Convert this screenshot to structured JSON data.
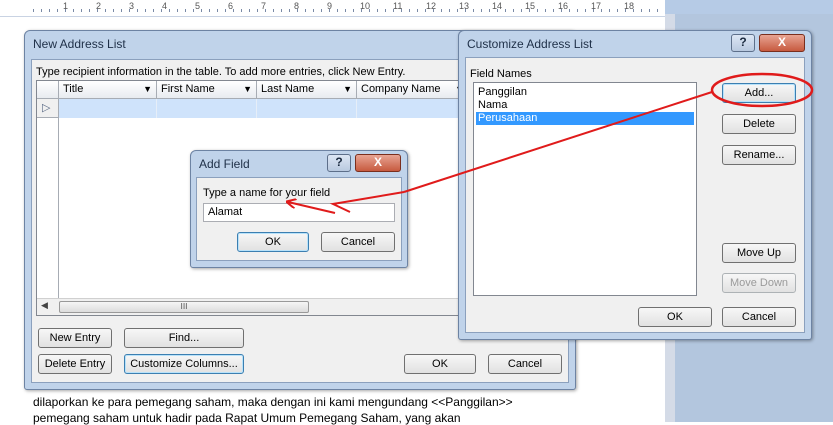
{
  "ruler": {
    "numbers": [
      "1",
      "2",
      "3",
      "4",
      "5",
      "6",
      "7",
      "8",
      "9",
      "10",
      "11",
      "12",
      "13",
      "14",
      "15",
      "16",
      "17",
      "18"
    ]
  },
  "document": {
    "line1": "dilaporkan ke para pemegang saham, maka dengan ini kami mengundang <<Panggilan>>",
    "line2": "pemegang saham untuk hadir pada Rapat Umum Pemegang Saham, yang akan"
  },
  "new_address_list": {
    "title": "New Address List",
    "instruction": "Type recipient information in the table.  To add more entries, click New Entry.",
    "columns": [
      "Title",
      "First Name",
      "Last Name",
      "Company Name"
    ],
    "scroll_thumb": "III",
    "buttons": {
      "new_entry": "New Entry",
      "find": "Find...",
      "delete_entry": "Delete Entry",
      "customize_columns": "Customize Columns...",
      "ok": "OK",
      "cancel": "Cancel"
    }
  },
  "customize_address_list": {
    "title": "Customize Address List",
    "help": "?",
    "close": "X",
    "field_names_label": "Field Names",
    "fields": [
      "Panggilan",
      "Nama",
      "Perusahaan"
    ],
    "selected_index": 2,
    "buttons": {
      "add": "Add...",
      "delete": "Delete",
      "rename": "Rename...",
      "move_up": "Move Up",
      "move_down": "Move Down",
      "ok": "OK",
      "cancel": "Cancel"
    }
  },
  "add_field": {
    "title": "Add Field",
    "help": "?",
    "close": "X",
    "prompt": "Type a name for your field",
    "value": "Alamat",
    "buttons": {
      "ok": "OK",
      "cancel": "Cancel"
    }
  },
  "colors": {
    "annotation": "#e01b1b",
    "selection": "#3399ff",
    "dialog_frame": "#c0d3ea"
  }
}
